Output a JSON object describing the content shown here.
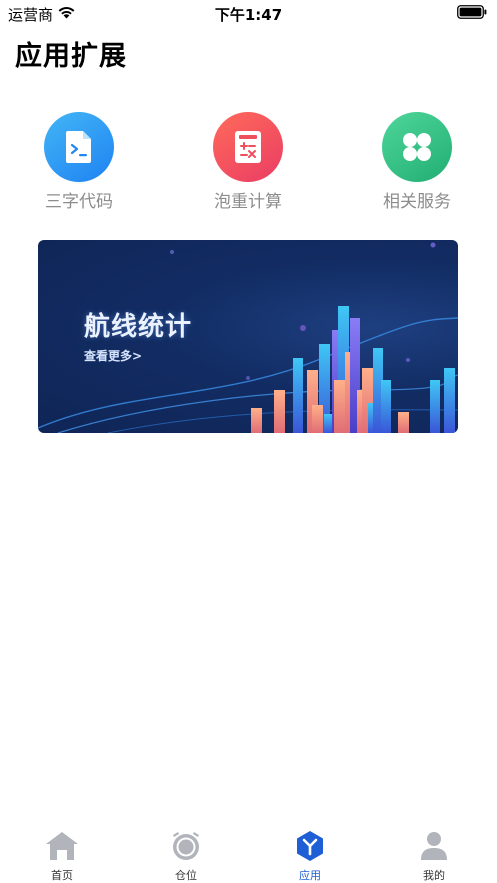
{
  "status_bar": {
    "carrier": "运营商",
    "time": "下午1:47"
  },
  "page": {
    "title": "应用扩展"
  },
  "apps": [
    {
      "label": "三字代码",
      "icon": "code-file-icon"
    },
    {
      "label": "泡重计算",
      "icon": "calculator-icon"
    },
    {
      "label": "相关服务",
      "icon": "clover-icon"
    }
  ],
  "banner": {
    "title": "航线统计",
    "subtitle": "查看更多>"
  },
  "tabbar": {
    "active": "应用",
    "items": [
      {
        "label": "首页",
        "icon": "home-icon"
      },
      {
        "label": "仓位",
        "icon": "warehouse-icon"
      },
      {
        "label": "应用",
        "icon": "apps-icon"
      },
      {
        "label": "我的",
        "icon": "user-icon"
      }
    ]
  },
  "colors": {
    "accent": "#1f5fd6",
    "blue": "#2f8cf4",
    "red": "#f04a5f",
    "green": "#2fbd82",
    "banner_bg": "#122c63"
  }
}
